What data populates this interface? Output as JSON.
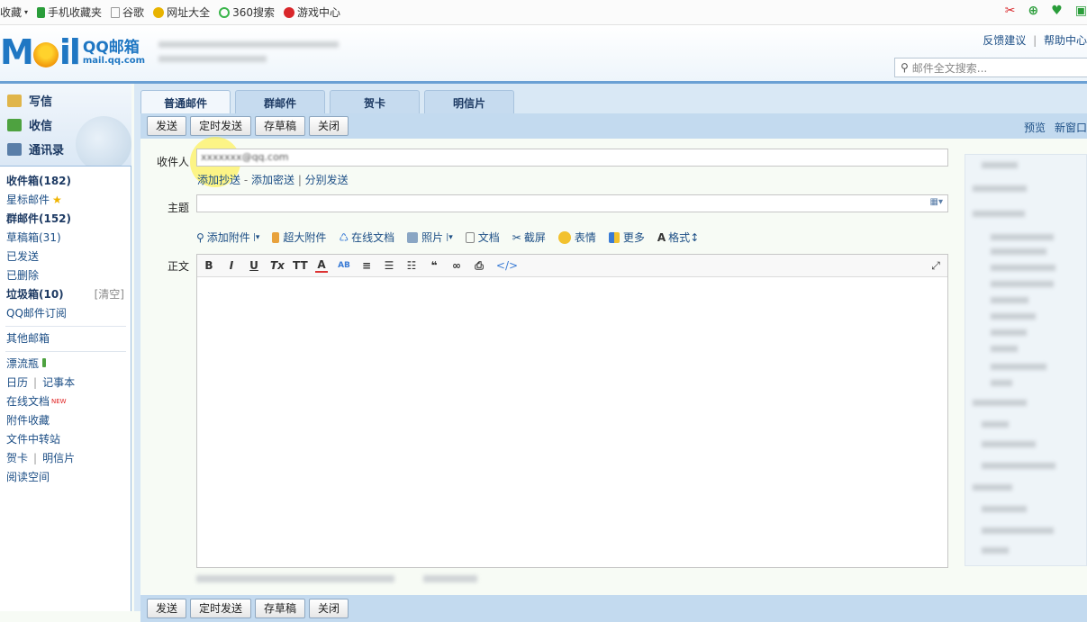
{
  "bookmarks": {
    "items": [
      {
        "label": "收藏",
        "icon": "chevron-down-icon"
      },
      {
        "label": "手机收藏夹",
        "icon": "phone-icon",
        "color": "#2a9d3a"
      },
      {
        "label": "谷歌",
        "icon": "page-icon",
        "color": "#999999"
      },
      {
        "label": "网址大全",
        "icon": "arrow-icon",
        "color": "#e8b300"
      },
      {
        "label": "360搜索",
        "icon": "search-circle-icon",
        "color": "#39b54a"
      },
      {
        "label": "游戏中心",
        "icon": "game-icon",
        "color": "#d9262a"
      }
    ]
  },
  "header": {
    "feedback": "反馈建议",
    "help": "帮助中心",
    "separator": "|",
    "search_placeholder": "邮件全文搜索...",
    "logo_text": "QQ邮箱",
    "logo_domain": "mail.qq.com"
  },
  "sidebar": {
    "actions": [
      {
        "label": "写信",
        "icon": "compose-icon"
      },
      {
        "label": "收信",
        "icon": "inbox-download-icon"
      },
      {
        "label": "通讯录",
        "icon": "contacts-icon"
      }
    ],
    "folders": {
      "inbox": "收件箱(182)",
      "starred": "星标邮件",
      "group": "群邮件(152)",
      "drafts": "草稿箱(31)",
      "sent": "已发送",
      "deleted": "已删除",
      "spam": "垃圾箱(10)",
      "spam_clear": "[清空]",
      "subscriptions": "QQ邮件订阅"
    },
    "other": "其他邮箱",
    "apps": {
      "drift": "漂流瓶",
      "calendar": "日历",
      "sep": "|",
      "notes": "记事本",
      "docs": "在线文档",
      "docs_badge": "NEW",
      "attachments": "附件收藏",
      "transfer": "文件中转站",
      "card": "贺卡",
      "postcard": "明信片",
      "reading": "阅读空间"
    }
  },
  "compose": {
    "tabs": [
      "普通邮件",
      "群邮件",
      "贺卡",
      "明信片"
    ],
    "toolbar": {
      "send": "发送",
      "scheduled": "定时发送",
      "save_draft": "存草稿",
      "close": "关闭",
      "preview": "预览",
      "new_window": "新窗口"
    },
    "to_label": "收件人",
    "to_value": "xxxxxxx@qq.com",
    "recipient_links": {
      "cc": "添加抄送",
      "dash": " - ",
      "bcc": "添加密送",
      "sep": " | ",
      "separate": "分别发送"
    },
    "subject_label": "主题",
    "attach": {
      "add": "添加附件",
      "large": "超大附件",
      "online_doc": "在线文档",
      "photo": "照片",
      "doc": "文档",
      "screenshot": "截屏",
      "emoji": "表情",
      "more": "更多",
      "format": "格式"
    },
    "body_label": "正文",
    "editor_tools": [
      "B",
      "I",
      "U",
      "Tx",
      "TT",
      "A",
      "AB",
      "≡",
      "☰",
      "☷",
      "❝",
      "∞",
      "⎙",
      "</>"
    ]
  }
}
